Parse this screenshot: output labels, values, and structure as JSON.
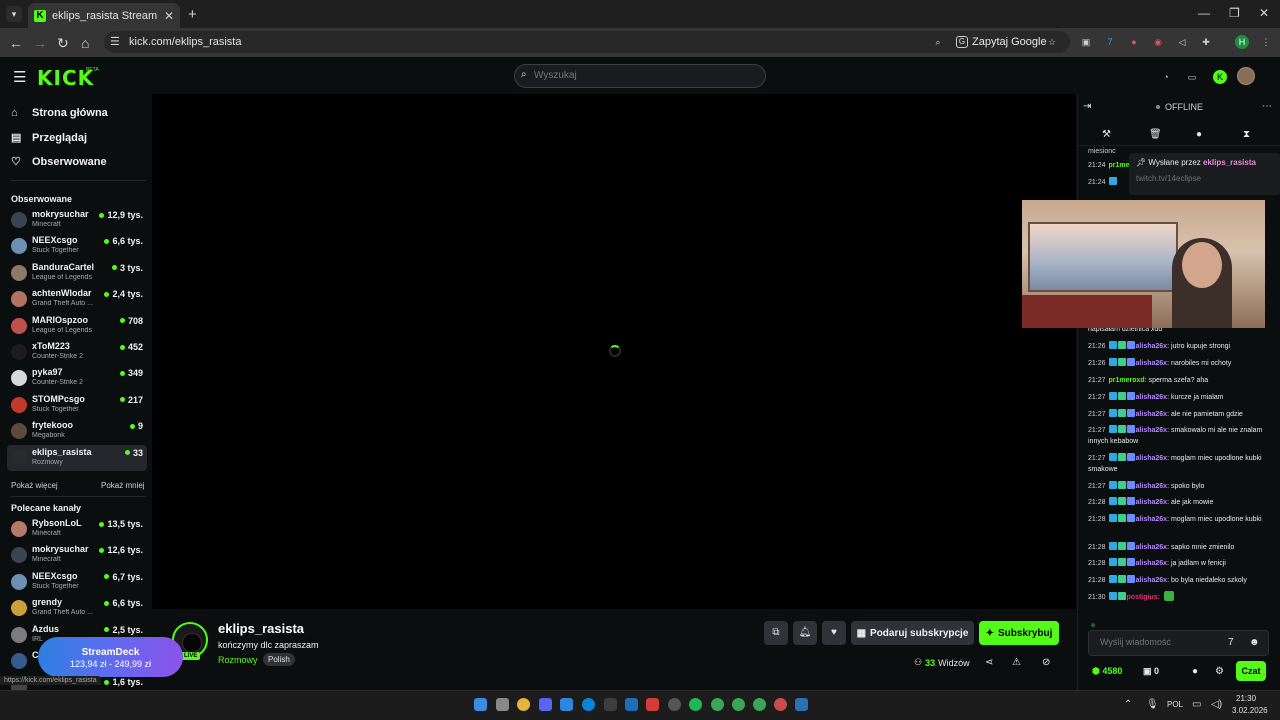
{
  "browser": {
    "tab_title": "eklips_rasista Stream - Watch Li",
    "url": "kick.com/eklips_rasista",
    "ask_google": "Zapytaj Google",
    "profile_initial": "H"
  },
  "header": {
    "logo": "KICK",
    "beta": "BETA",
    "search_placeholder": "Wyszukaj"
  },
  "sidebar": {
    "nav": [
      {
        "label": "Strona główna",
        "icon": "home-icon"
      },
      {
        "label": "Przeglądaj",
        "icon": "browse-icon"
      },
      {
        "label": "Obserwowane",
        "icon": "heart-icon"
      }
    ],
    "following_title": "Obserwowane",
    "following": [
      {
        "name": "mokrysuchar",
        "game": "Minecraft",
        "viewers": "12,9 tys.",
        "color": "#3b4450"
      },
      {
        "name": "NEEXcsgo",
        "game": "Stuck Together",
        "viewers": "6,6 tys.",
        "color": "#6d8fb0"
      },
      {
        "name": "BanduraCartel",
        "game": "League of Legends",
        "viewers": "3 tys.",
        "color": "#8a7a66"
      },
      {
        "name": "achtenWlodar",
        "game": "Grand Theft Auto ...",
        "viewers": "2,4 tys.",
        "color": "#b27460"
      },
      {
        "name": "MARIOspzoo",
        "game": "League of Legends",
        "viewers": "708",
        "color": "#c0504e"
      },
      {
        "name": "xToM223",
        "game": "Counter-Strike 2",
        "viewers": "452",
        "color": "#1c1c1c"
      },
      {
        "name": "pyka97",
        "game": "Counter-Strike 2",
        "viewers": "349",
        "color": "#d7d7d7"
      },
      {
        "name": "STOMPcsgo",
        "game": "Stuck Together",
        "viewers": "217",
        "color": "#c0392b"
      },
      {
        "name": "frytekooo",
        "game": "Megabonk",
        "viewers": "9",
        "color": "#5b4a3e"
      },
      {
        "name": "eklips_rasista",
        "game": "Rozmowy",
        "viewers": "33",
        "color": "#2a2a2a"
      }
    ],
    "show_more": "Pokaż więcej",
    "show_less": "Pokaż mniej",
    "recommended_title": "Polecane kanały",
    "recommended": [
      {
        "name": "RybsonLoL",
        "game": "Minecraft",
        "viewers": "13,5 tys.",
        "color": "#b57a6a"
      },
      {
        "name": "mokrysuchar",
        "game": "Minecraft",
        "viewers": "12,6 tys.",
        "color": "#3b4450"
      },
      {
        "name": "NEEXcsgo",
        "game": "Stuck Together",
        "viewers": "6,7 tys.",
        "color": "#6d8fb0"
      },
      {
        "name": "grendy",
        "game": "Grand Theft Auto ...",
        "viewers": "6,6 tys.",
        "color": "#c9a13a"
      },
      {
        "name": "Azdus",
        "game": "IRL",
        "viewers": "2,5 tys.",
        "color": "#7c7c7c"
      },
      {
        "name": "C",
        "game": "",
        "viewers": "",
        "color": "#365a8a"
      },
      {
        "name": "xmentacion",
        "game": "",
        "viewers": "1,6 tys.",
        "color": "#444"
      }
    ]
  },
  "stream": {
    "name": "eklips_rasista",
    "title": "kończymy dlc zapraszam",
    "category": "Rozmowy",
    "language": "Polish",
    "live": "LIVE",
    "gift_sub": "Podaruj subskrypcje",
    "subscribe": "Subskrybuj",
    "viewers_num": "33",
    "viewers_label": "Widzów"
  },
  "promo": {
    "title": "StreamDeck",
    "price": "123,94 zł - 249,99 zł",
    "status_url": "https://kick.com/eklips_rasista"
  },
  "chat": {
    "status": "OFFLINE",
    "pinned_label": "Wysłane przez",
    "pinned_user": "eklips_rasista",
    "pinned_link": "twitch.tv/14eclipse",
    "top_fragment": "miesionc",
    "messages": [
      {
        "time": "21:24",
        "user": "pr1meroxd",
        "text": "",
        "badges": 0,
        "ucls": "ug"
      },
      {
        "time": "21:24",
        "user": "",
        "text": "",
        "badges": 1,
        "ucls": "u"
      },
      {
        "time": "",
        "user": "",
        "text": "napisałam dzielnica xdd",
        "badges": 0,
        "ucls": "u"
      },
      {
        "time": "21:26",
        "user": "alisha26x",
        "text": "jutro kupuje strongi",
        "badges": 3,
        "ucls": "u"
      },
      {
        "time": "21:26",
        "user": "alisha26x",
        "text": "narobiles mi ochoty",
        "badges": 3,
        "ucls": "u"
      },
      {
        "time": "21:27",
        "user": "pr1meroxd",
        "text": "sperma szefa? aha",
        "badges": 0,
        "ucls": "ug"
      },
      {
        "time": "21:27",
        "user": "alisha26x",
        "text": "kurcze ja mialam",
        "badges": 3,
        "ucls": "u"
      },
      {
        "time": "21:27",
        "user": "alisha26x",
        "text": "ale nie pamietam gdzie",
        "badges": 3,
        "ucls": "u"
      },
      {
        "time": "21:27",
        "user": "alisha26x",
        "text": "smakowalo mi ale nie znalam innych kebabow",
        "badges": 3,
        "ucls": "u"
      },
      {
        "time": "21:27",
        "user": "alisha26x",
        "text": "moglam miec upodlone kubki smakowe",
        "badges": 3,
        "ucls": "u"
      },
      {
        "time": "21:27",
        "user": "alisha26x",
        "text": "spoko bylo",
        "badges": 3,
        "ucls": "u"
      },
      {
        "time": "21:28",
        "user": "alisha26x",
        "text": "ale jak mowie",
        "badges": 3,
        "ucls": "u"
      },
      {
        "time": "21:28",
        "user": "alisha26x",
        "text": "moglam miec upodlone kubki",
        "badges": 3,
        "ucls": "u"
      },
      {
        "time": "21:28",
        "user": "alisha26x",
        "text": "sapko mnie zmienilo",
        "badges": 3,
        "ucls": "u"
      },
      {
        "time": "21:28",
        "user": "alisha26x",
        "text": "ja jadlam w fenicji",
        "badges": 3,
        "ucls": "u"
      },
      {
        "time": "21:28",
        "user": "alisha26x",
        "text": "bo byla niedaleko szkoly",
        "badges": 3,
        "ucls": "u"
      },
      {
        "time": "21:30",
        "user": "postigius:",
        "text": "",
        "badges": 2,
        "ucls": "ur"
      }
    ],
    "input_placeholder": "Wyślij wiadomość",
    "points": "4580",
    "points2": "0",
    "send": "Czat"
  },
  "taskbar": {
    "lang": "POL",
    "time": "21:30",
    "date": "3.02.2026"
  }
}
